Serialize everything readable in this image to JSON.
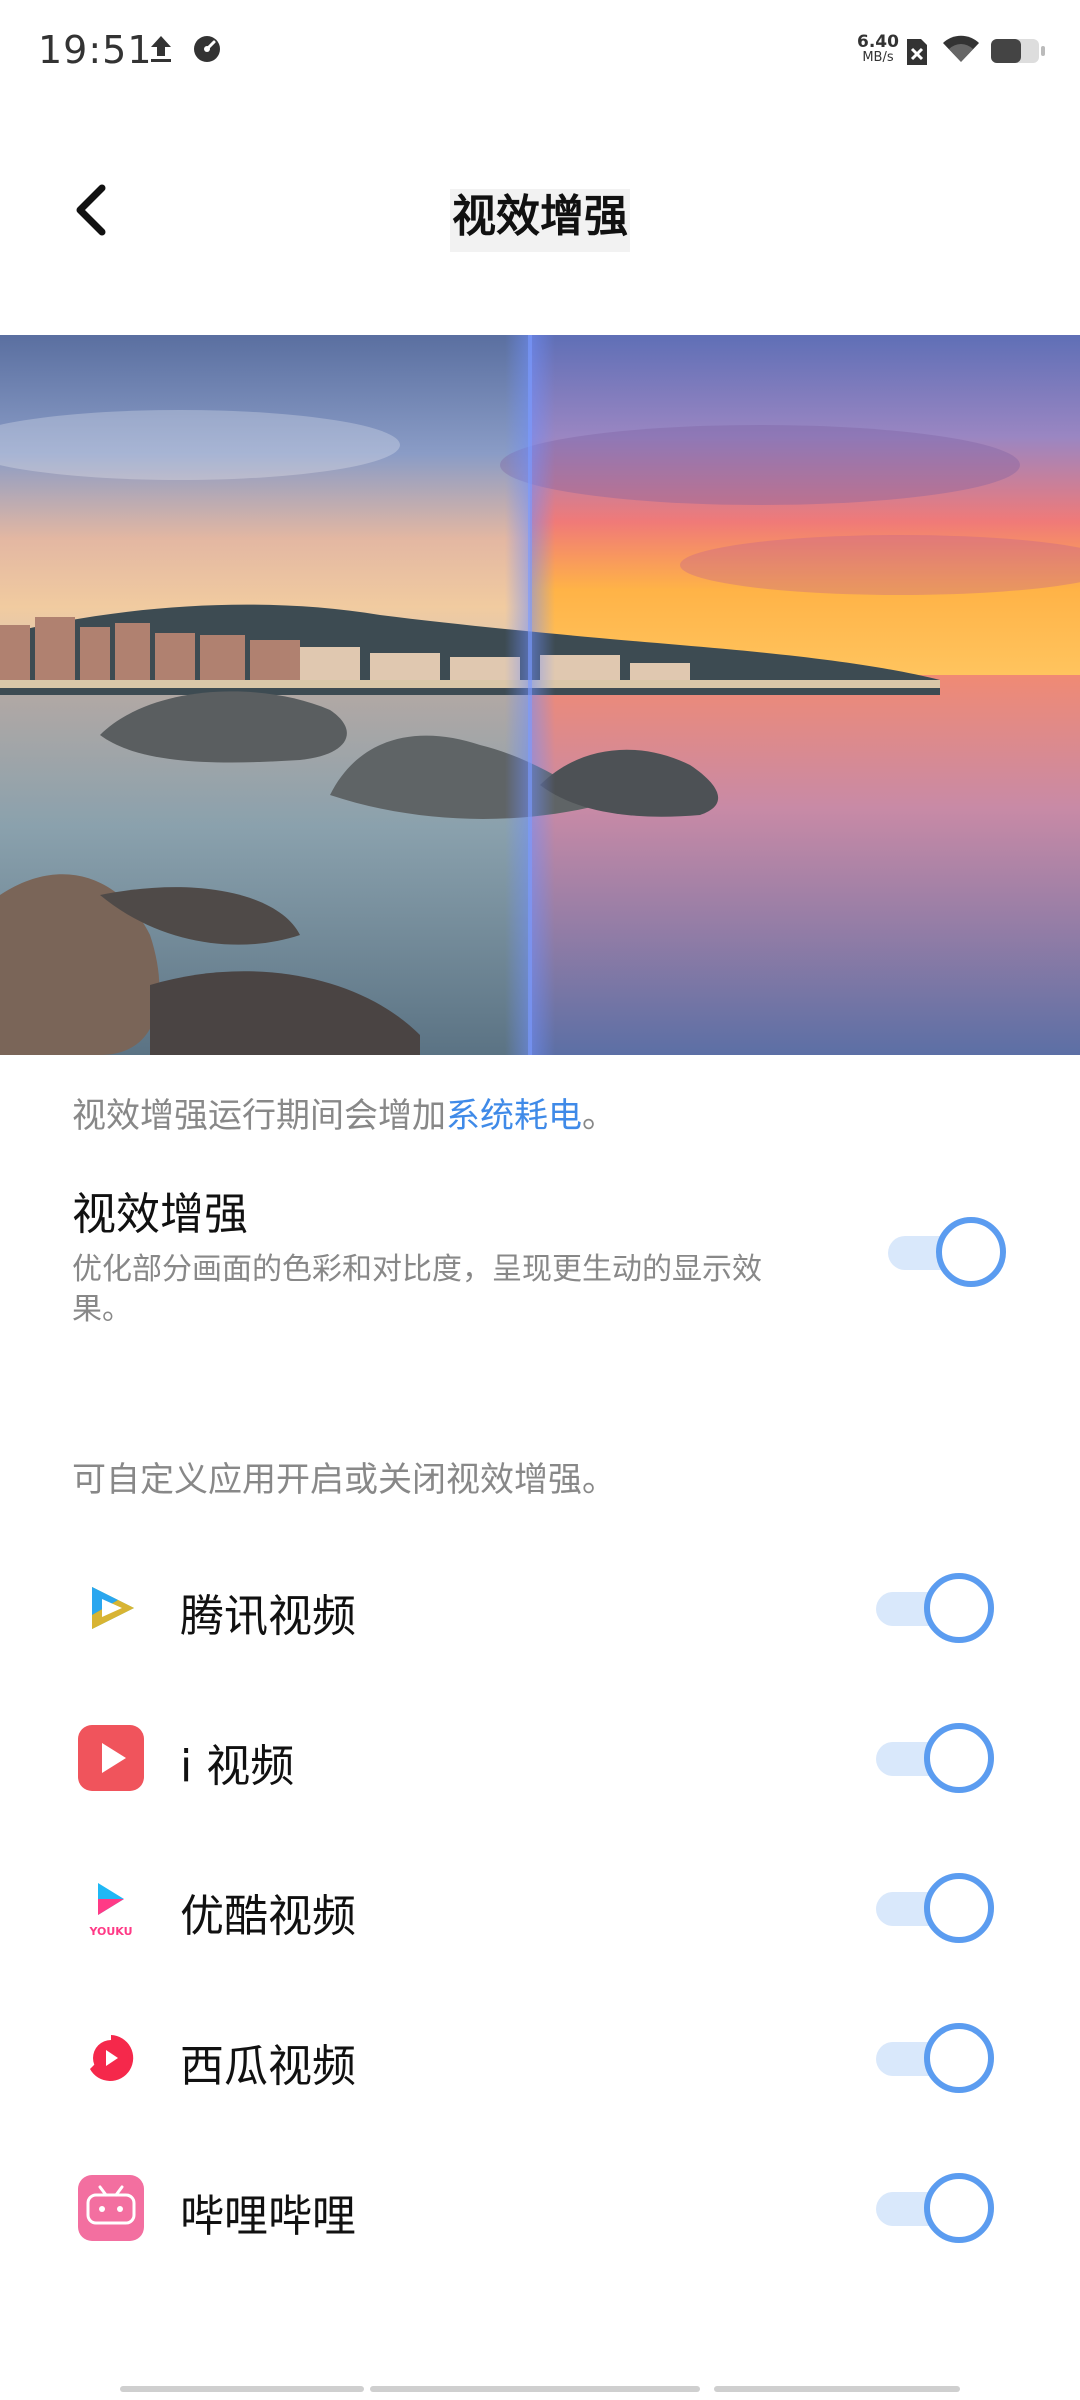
{
  "status_bar": {
    "time": "19:51",
    "net_speed_value": "6.40",
    "net_speed_unit": "MB/s",
    "icons": [
      "upload-icon",
      "gauge-icon",
      "sim-off-icon",
      "wifi-icon",
      "battery-icon"
    ]
  },
  "header": {
    "title": "视效增强",
    "back_icon": "chevron-left-icon"
  },
  "preview": {
    "description_icon": "before-after-landscape-image"
  },
  "notice": {
    "prefix": "视效增强运行期间会增加",
    "link": "系统耗电",
    "suffix": "。",
    "link_color": "#3f8ae8"
  },
  "visual_enhance": {
    "title": "视效增强",
    "description": "优化部分画面的色彩和对比度，呈现更生动的显示效果。",
    "enabled": true
  },
  "custom_note": "可自定义应用开启或关闭视效增强。",
  "apps": [
    {
      "name": "腾讯视频",
      "icon": "tencent-video-icon",
      "enabled": true
    },
    {
      "name": "i 视频",
      "icon": "ivideo-icon",
      "enabled": true
    },
    {
      "name": "优酷视频",
      "icon": "youku-icon",
      "enabled": true
    },
    {
      "name": "西瓜视频",
      "icon": "xigua-video-icon",
      "enabled": true
    },
    {
      "name": "哔哩哔哩",
      "icon": "bilibili-icon",
      "enabled": true
    }
  ],
  "colors": {
    "accent": "#5b9cf0",
    "toggle_track": "#d9e8fb",
    "secondary_text": "#888888"
  }
}
